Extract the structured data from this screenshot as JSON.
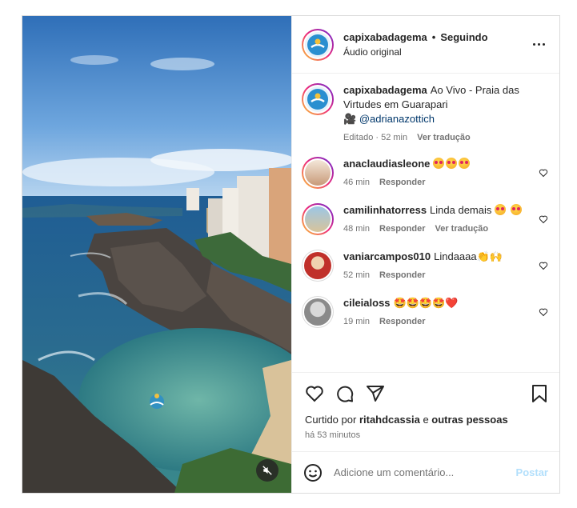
{
  "header": {
    "username": "capixabadagema",
    "separator": "•",
    "follow_status": "Seguindo",
    "audio": "Áudio original"
  },
  "caption": {
    "username": "capixabadagema",
    "text": "Ao Vivo - Praia das Virtudes em Guarapari",
    "camera_emoji": "🎥",
    "mention": "@adrianazottich",
    "edited": "Editado · 52 min",
    "translate": "Ver tradução"
  },
  "comments": [
    {
      "username": "anaclaudiasleone",
      "text": "",
      "emojis": 3,
      "time": "46 min",
      "reply": "Responder",
      "translate": ""
    },
    {
      "username": "camilinhatorress",
      "text": "Linda demais",
      "emojis": 2,
      "time": "48 min",
      "reply": "Responder",
      "translate": "Ver tradução"
    },
    {
      "username": "vaniarcampos010",
      "text": "Lindaaaa👏🙌",
      "emojis": 0,
      "time": "52 min",
      "reply": "Responder",
      "translate": ""
    },
    {
      "username": "cileialoss",
      "text": "🤩🤩🤩🤩❤️",
      "emojis": 0,
      "time": "19 min",
      "reply": "Responder",
      "translate": ""
    }
  ],
  "likes": {
    "prefix": "Curtido por",
    "user": "ritahdcassia",
    "connector": "e",
    "others": "outras pessoas"
  },
  "timestamp": "há 53 minutos",
  "composer": {
    "placeholder": "Adicione um comentário...",
    "post_label": "Postar"
  },
  "colors": {
    "accent_link": "#00376b",
    "post_button_disabled": "#b2dffc",
    "meta_gray": "#737373"
  }
}
